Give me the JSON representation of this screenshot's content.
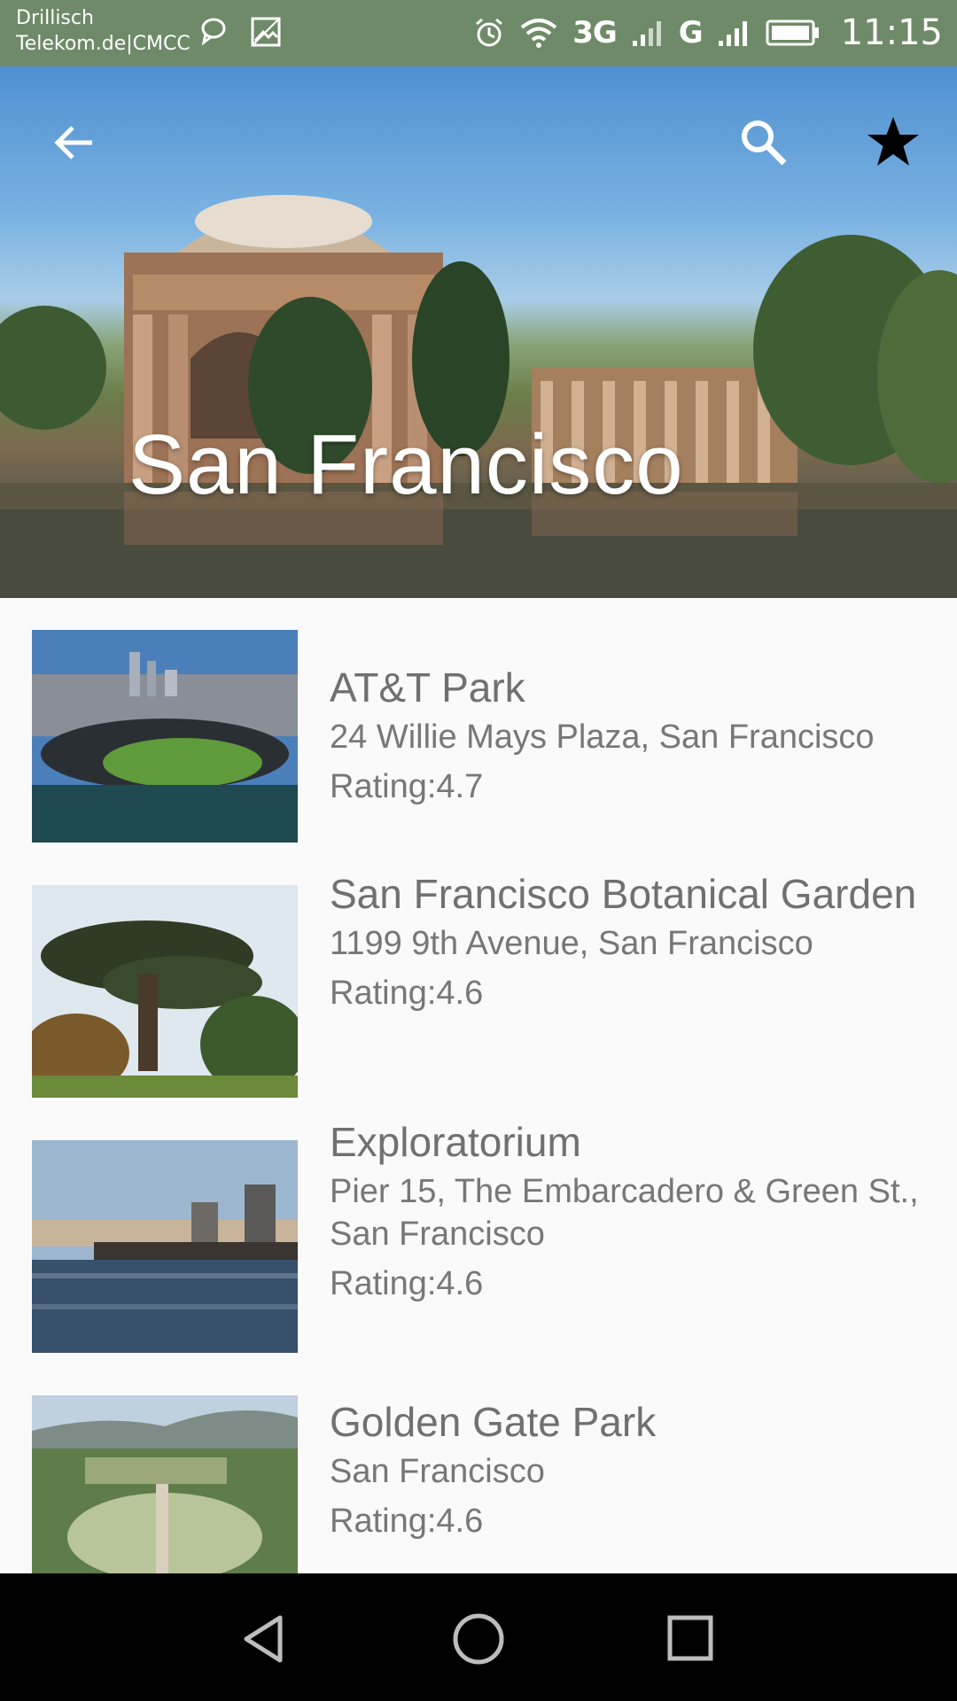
{
  "status_bar": {
    "carrier_line1": "Drillisch",
    "carrier_line2": "Telekom.de|CMCC",
    "network_1": "3G",
    "network_2": "G",
    "time": "11:15",
    "icons": [
      "chat-icon",
      "image-icon",
      "alarm-icon",
      "wifi-icon",
      "signal-icon",
      "battery-icon"
    ]
  },
  "header": {
    "title": "San Francisco",
    "back_icon": "arrow-back-icon",
    "search_icon": "search-icon",
    "favorite_icon": "star-icon"
  },
  "places": [
    {
      "name": "AT&T Park",
      "address": "24 Willie Mays Plaza, San Francisco",
      "rating": "Rating:4.7"
    },
    {
      "name": "San Francisco Botanical Garden",
      "address": "1199 9th Avenue, San Francisco",
      "rating": "Rating:4.6"
    },
    {
      "name": "Exploratorium",
      "address": "Pier 15, The Embarcadero & Green St., San Francisco",
      "rating": "Rating:4.6"
    },
    {
      "name": "Golden Gate Park",
      "address": "San Francisco",
      "rating": "Rating:4.6"
    }
  ],
  "nav": {
    "back": "nav-back-icon",
    "home": "nav-home-icon",
    "recents": "nav-recents-icon"
  },
  "colors": {
    "status_bar": "#6e8a68",
    "list_background": "#fafafa",
    "text": "#757575",
    "nav_bar": "#000000"
  }
}
